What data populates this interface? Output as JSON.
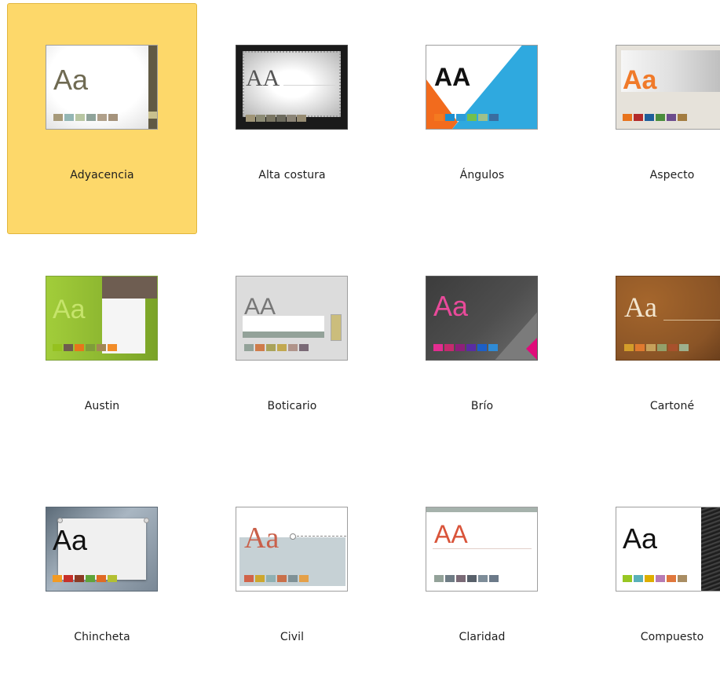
{
  "themes": [
    {
      "name": "Adyacencia",
      "sample_text": "Aa",
      "selected": true,
      "colors": [
        "#a79a7a",
        "#94b6b4",
        "#b8c6a2",
        "#8fa39a",
        "#b0a08a",
        "#a5937c"
      ]
    },
    {
      "name": "Alta costura",
      "sample_text": "AA",
      "colors": [
        "#a09577",
        "#8c8b75",
        "#7a7663",
        "#6d6b5e",
        "#8b8476",
        "#978c73"
      ]
    },
    {
      "name": "Ángulos",
      "sample_text": "AA",
      "colors": [
        "#f47a20",
        "#1c8fd0",
        "#2c9cd8",
        "#72c04e",
        "#9fc08a",
        "#3a6da0"
      ]
    },
    {
      "name": "Aspecto",
      "sample_text": "Aa",
      "colors": [
        "#e8731c",
        "#b32a2a",
        "#1e5e9a",
        "#4a8d3c",
        "#6c4c8d",
        "#a37c40"
      ]
    },
    {
      "name": "Austin",
      "sample_text": "Aa",
      "colors": [
        "#95c11f",
        "#6e5c4e",
        "#e6761b",
        "#7f9c3a",
        "#a38754",
        "#f28c28"
      ]
    },
    {
      "name": "Boticario",
      "sample_text": "AA",
      "colors": [
        "#93a299",
        "#cf7c4a",
        "#a9a35a",
        "#c2a84f",
        "#b0948a",
        "#7a6a76"
      ]
    },
    {
      "name": "Brío",
      "sample_text": "Aa",
      "colors": [
        "#e32d91",
        "#c62a6e",
        "#8e1f7a",
        "#5a2ca3",
        "#1c5fc8",
        "#2f8bd6"
      ]
    },
    {
      "name": "Cartoné",
      "sample_text": "Aa",
      "colors": [
        "#d39d2a",
        "#e07a2f",
        "#c6a15b",
        "#93a06a",
        "#a8512c",
        "#9db08d"
      ]
    },
    {
      "name": "Chincheta",
      "sample_text": "Aa",
      "colors": [
        "#f39a22",
        "#c6302a",
        "#8c3a24",
        "#5fa43a",
        "#e06a24",
        "#b3c032"
      ]
    },
    {
      "name": "Civil",
      "sample_text": "Aa",
      "colors": [
        "#d16349",
        "#cda72e",
        "#8fb0b3",
        "#c9704a",
        "#7f9196",
        "#e4a048"
      ]
    },
    {
      "name": "Claridad",
      "sample_text": "AA",
      "colors": [
        "#93a299",
        "#6f7c85",
        "#7a6a76",
        "#58606a",
        "#7e8d99",
        "#6c7a89"
      ]
    },
    {
      "name": "Compuesto",
      "sample_text": "Aa",
      "colors": [
        "#98c723",
        "#59b0b9",
        "#deae00",
        "#b77bb4",
        "#e0773c",
        "#a98d63"
      ]
    }
  ]
}
